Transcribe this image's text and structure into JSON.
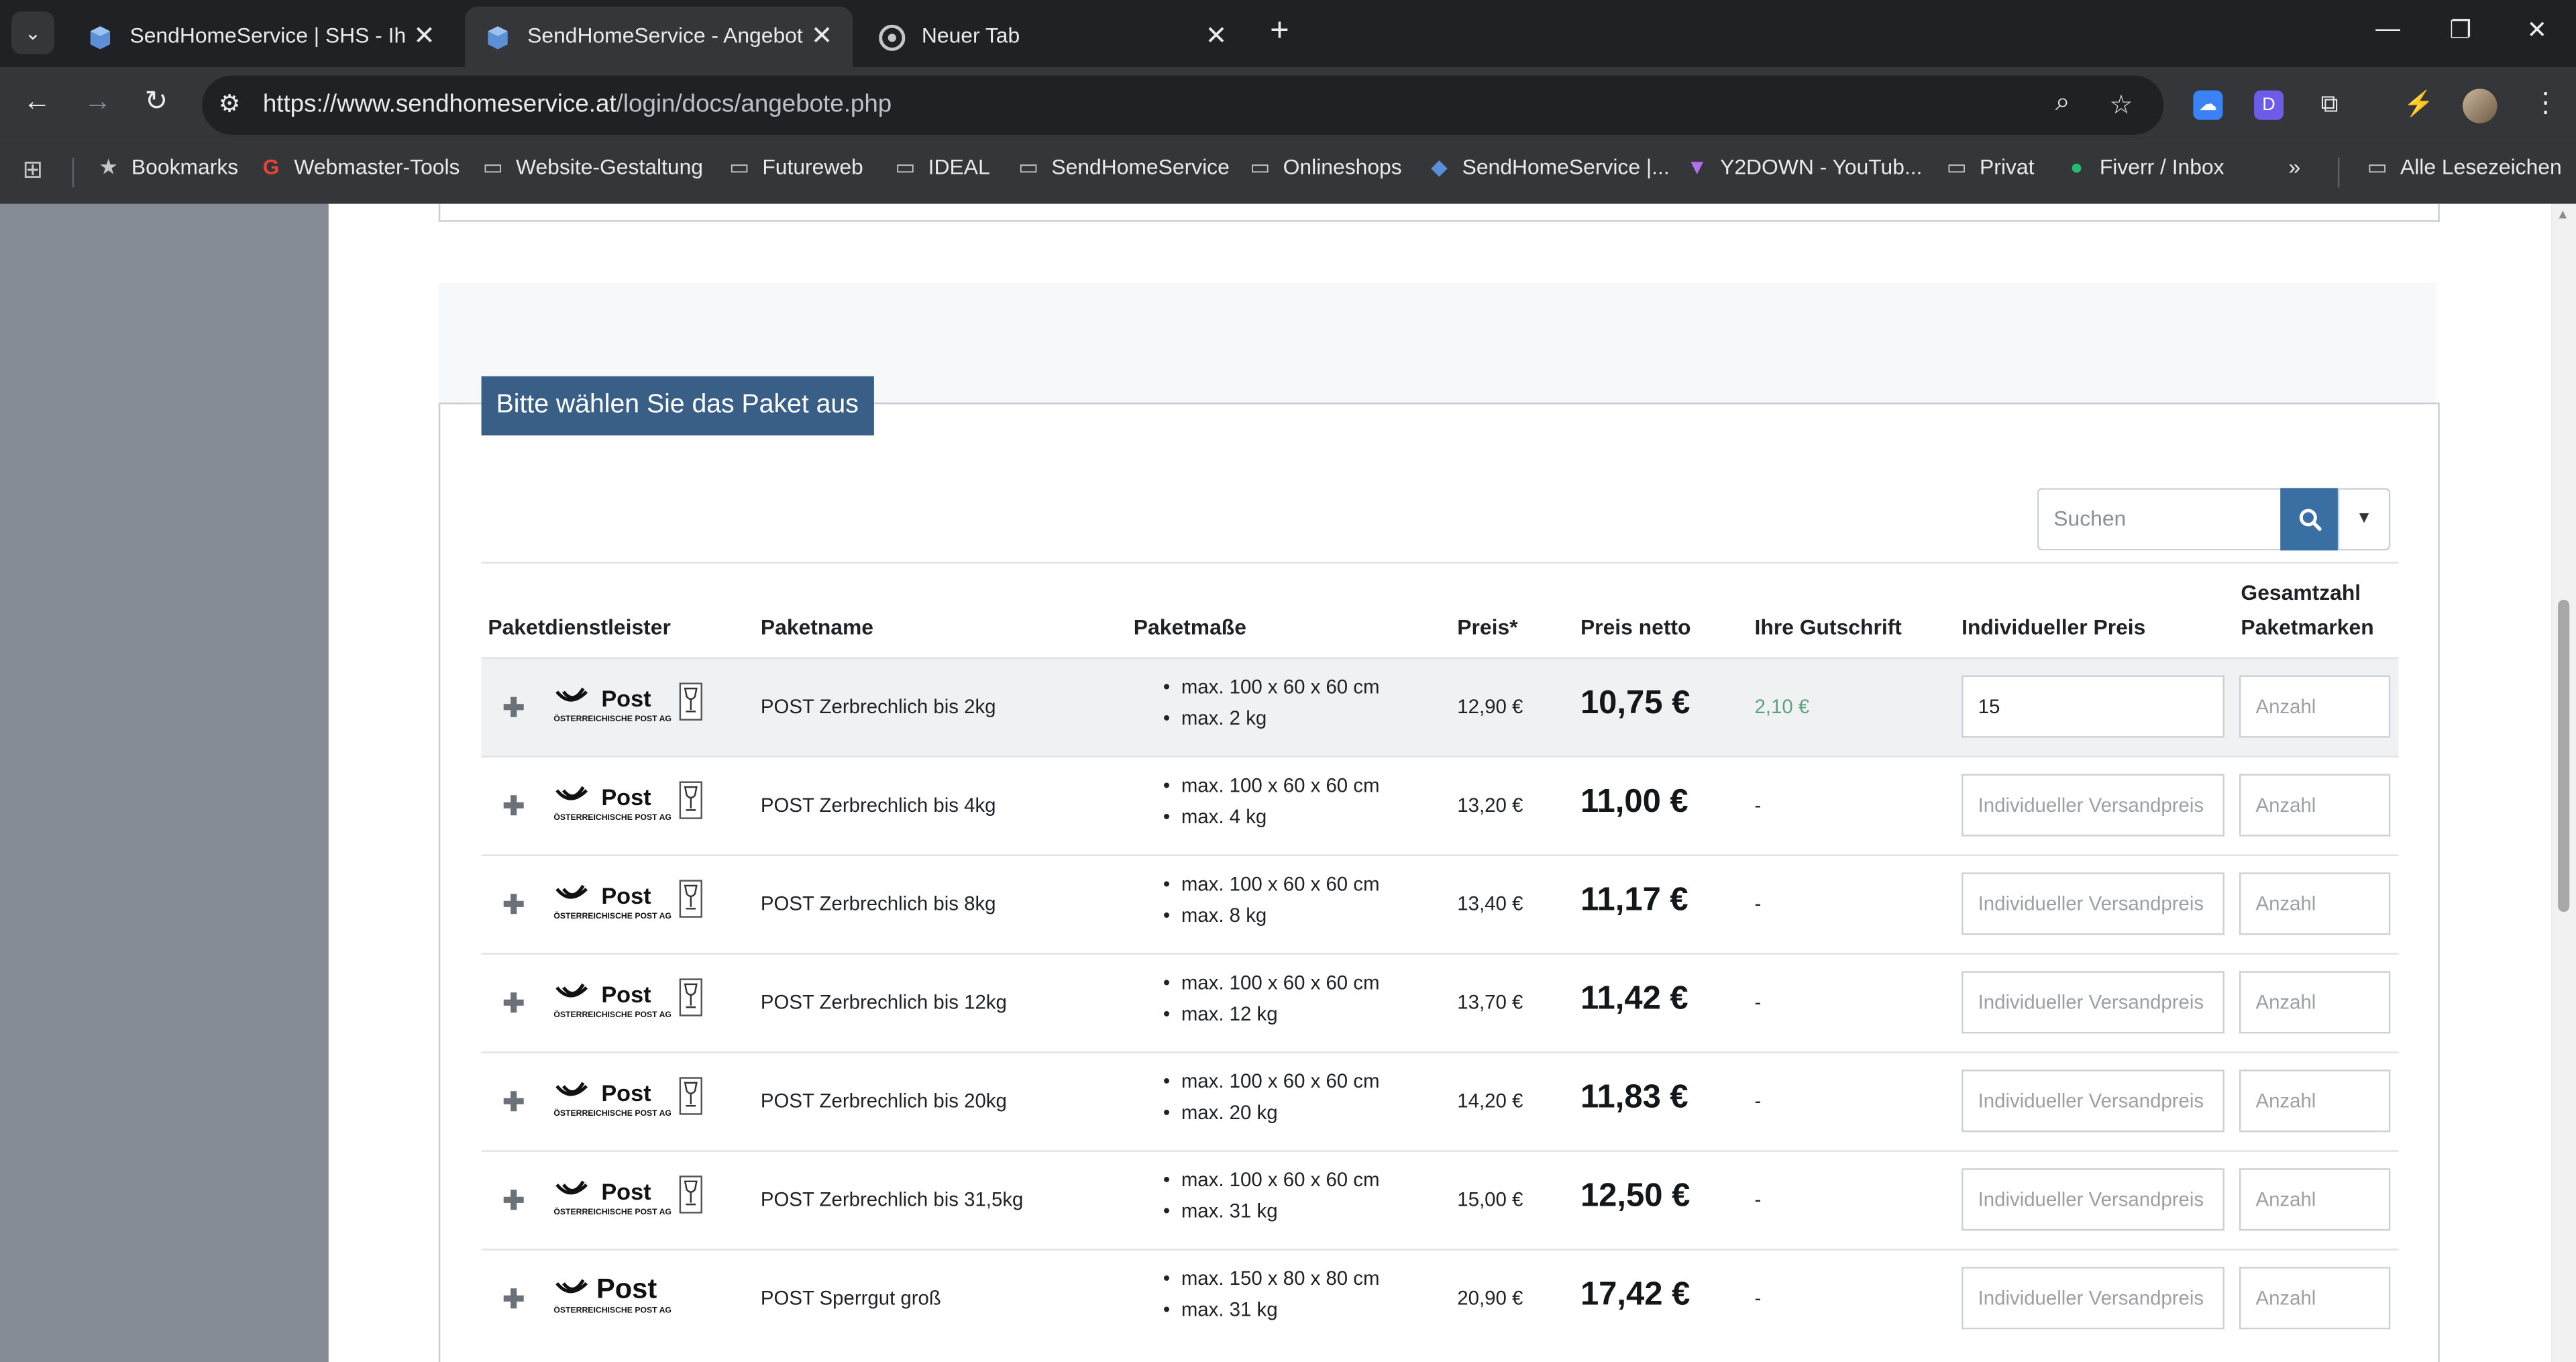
{
  "browser": {
    "tabs": [
      {
        "title": "SendHomeService | SHS - Ihr pr",
        "active": false
      },
      {
        "title": "SendHomeService - Angebot ve",
        "active": true
      },
      {
        "title": "Neuer Tab",
        "active": false
      }
    ],
    "url_host": "https://www.sendhomeservice.at",
    "url_path": "/login/docs/angebote.php",
    "bookmarks": [
      {
        "label": "Bookmarks",
        "icon": "star-icon"
      },
      {
        "label": "Webmaster-Tools",
        "icon": "google-icon"
      },
      {
        "label": "Website-Gestaltung",
        "icon": "folder-icon"
      },
      {
        "label": "Futureweb",
        "icon": "folder-icon"
      },
      {
        "label": "IDEAL",
        "icon": "folder-icon"
      },
      {
        "label": "SendHomeService",
        "icon": "folder-icon"
      },
      {
        "label": "Onlineshops",
        "icon": "folder-icon"
      },
      {
        "label": "SendHomeService |...",
        "icon": "cube-icon"
      },
      {
        "label": "Y2DOWN - YouTub...",
        "icon": "y2down-icon"
      },
      {
        "label": "Privat",
        "icon": "folder-icon"
      },
      {
        "label": "Fiverr / Inbox",
        "icon": "fiverr-icon"
      }
    ],
    "all_bookmarks": "Alle Lesezeichen"
  },
  "section": {
    "legend": "Bitte wählen Sie das Paket aus",
    "search_placeholder": "Suchen"
  },
  "table": {
    "headers": {
      "provider": "Paketdienstleister",
      "name": "Paketname",
      "dims": "Paketmaße",
      "price": "Preis*",
      "netto": "Preis netto",
      "credit": "Ihre Gutschrift",
      "indiv": "Individueller Preis",
      "total_line1": "Gesamtzahl",
      "total_line2": "Paketmarken"
    },
    "indiv_placeholder": "Individueller Versandpreis",
    "anzahl_placeholder": "Anzahl",
    "rows": [
      {
        "logo_text": "Post",
        "logo_sub": "ÖSTERREICHISCHE POST AG",
        "name": "POST Zerbrechlich bis 2kg",
        "dim1": "max. 100 x 60 x 60 cm",
        "dim2": "max. 2 kg",
        "price": "12,90 €",
        "netto": "10,75 €",
        "credit": "2,10 €",
        "indiv_value": "15"
      },
      {
        "logo_text": "Post",
        "logo_sub": "ÖSTERREICHISCHE POST AG",
        "name": "POST Zerbrechlich bis 4kg",
        "dim1": "max. 100 x 60 x 60 cm",
        "dim2": "max. 4 kg",
        "price": "13,20 €",
        "netto": "11,00 €",
        "credit": "-"
      },
      {
        "logo_text": "Post",
        "logo_sub": "ÖSTERREICHISCHE POST AG",
        "name": "POST Zerbrechlich bis 8kg",
        "dim1": "max. 100 x 60 x 60 cm",
        "dim2": "max. 8 kg",
        "price": "13,40 €",
        "netto": "11,17 €",
        "credit": "-"
      },
      {
        "logo_text": "Post",
        "logo_sub": "ÖSTERREICHISCHE POST AG",
        "name": "POST Zerbrechlich bis 12kg",
        "dim1": "max. 100 x 60 x 60 cm",
        "dim2": "max. 12 kg",
        "price": "13,70 €",
        "netto": "11,42 €",
        "credit": "-"
      },
      {
        "logo_text": "Post",
        "logo_sub": "ÖSTERREICHISCHE POST AG",
        "name": "POST Zerbrechlich bis 20kg",
        "dim1": "max. 100 x 60 x 60 cm",
        "dim2": "max. 20 kg",
        "price": "14,20 €",
        "netto": "11,83 €",
        "credit": "-"
      },
      {
        "logo_text": "Post",
        "logo_sub": "ÖSTERREICHISCHE POST AG",
        "name": "POST Zerbrechlich bis 31,5kg",
        "dim1": "max. 100 x 60 x 60 cm",
        "dim2": "max. 31 kg",
        "price": "15,00 €",
        "netto": "12,50 €",
        "credit": "-"
      },
      {
        "logo_text": "Post",
        "logo_sub": "ÖSTERREICHISCHE POST AG",
        "name": "POST Sperrgut groß",
        "dim1": "max. 150 x 80 x 80 cm",
        "dim2": "max. 31 kg",
        "price": "20,90 €",
        "netto": "17,42 €",
        "credit": "-"
      }
    ]
  },
  "colors": {
    "accent": "#3a5f86",
    "search_button": "#3a6fa4",
    "credit_green": "#5ba27d"
  }
}
